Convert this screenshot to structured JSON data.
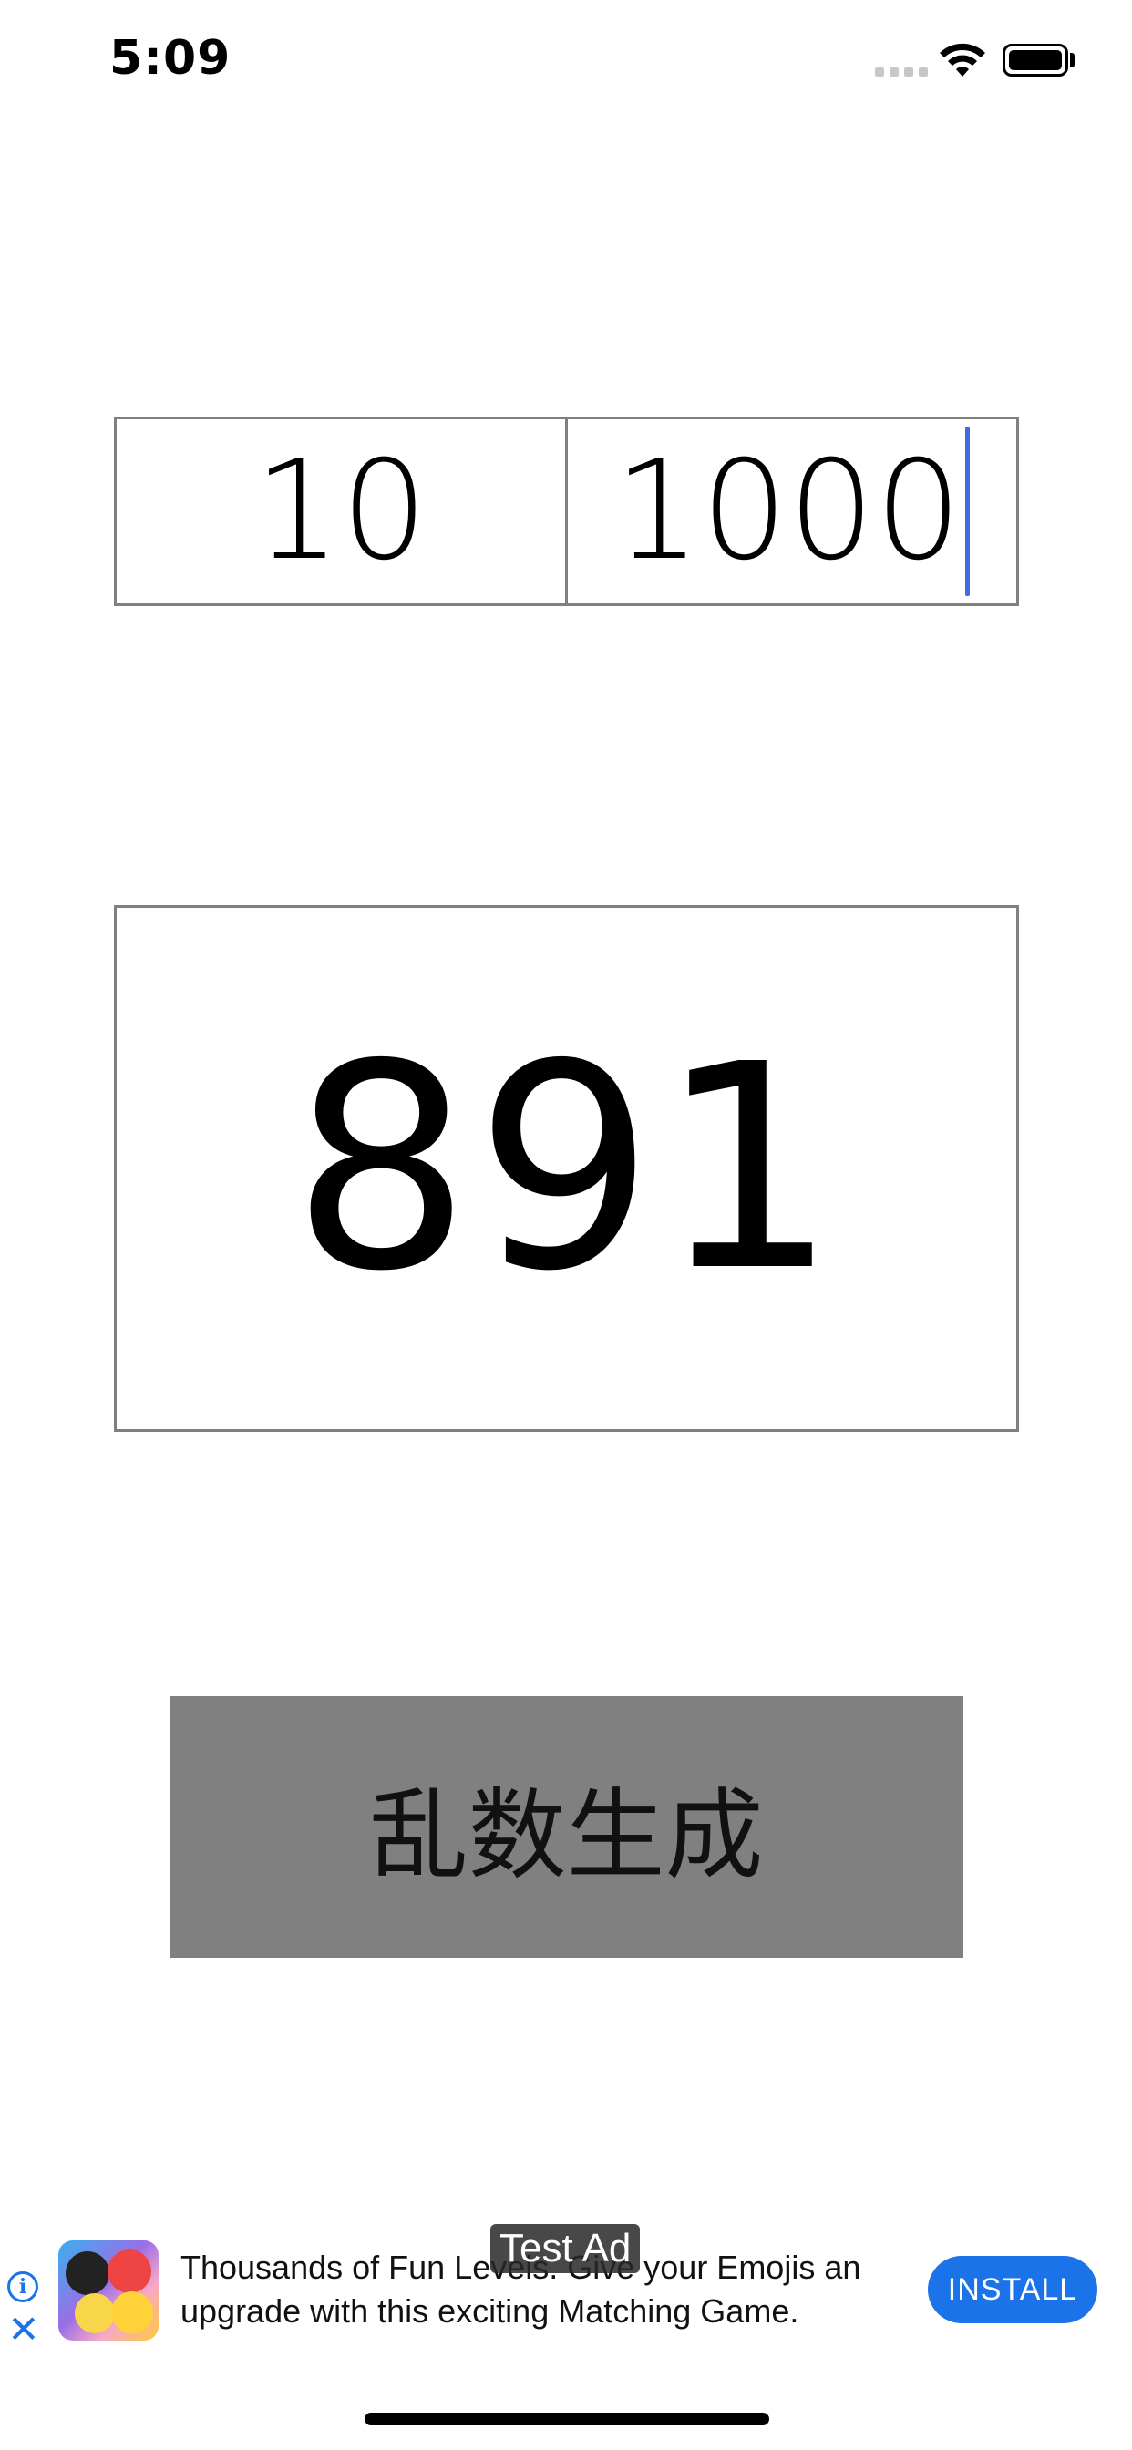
{
  "status_bar": {
    "time": "5:09"
  },
  "range": {
    "min_value": "10",
    "max_value": "1000",
    "caret_color": "#3d6ce4"
  },
  "result": {
    "value": "891"
  },
  "generate_button": {
    "label": "乱数生成",
    "background": "#808080"
  },
  "ad": {
    "label": "Test Ad",
    "text_line1": "Thousands of Fun Levels. Give your Emojis an",
    "text_line2": "upgrade with this exciting Matching Game.",
    "install_label": "INSTALL",
    "accent": "#1a73e8",
    "info_icon": "info-icon",
    "close_icon": "close-icon"
  }
}
